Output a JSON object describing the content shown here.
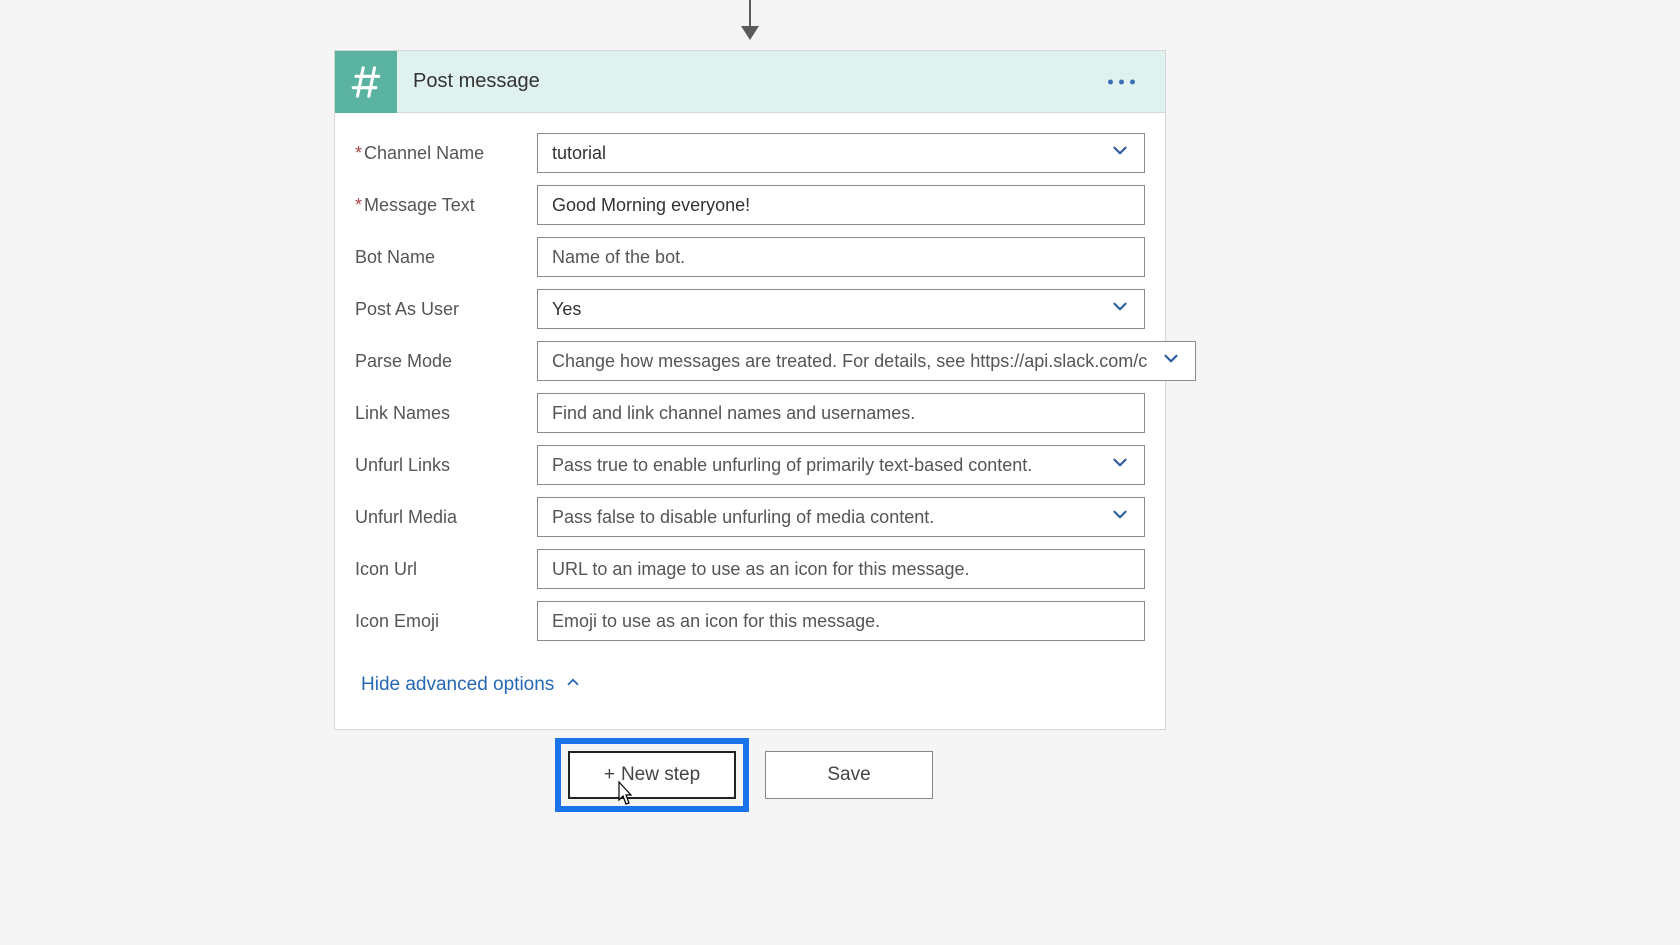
{
  "card": {
    "title": "Post message",
    "advanced_toggle_label": "Hide advanced options"
  },
  "fields": {
    "channel_name": {
      "label": "Channel Name",
      "value": "tutorial"
    },
    "message_text": {
      "label": "Message Text",
      "value": "Good Morning everyone!"
    },
    "bot_name": {
      "label": "Bot Name",
      "placeholder": "Name of the bot."
    },
    "post_as_user": {
      "label": "Post As User",
      "value": "Yes"
    },
    "parse_mode": {
      "label": "Parse Mode",
      "placeholder": "Change how messages are treated. For details, see https://api.slack.com/c"
    },
    "link_names": {
      "label": "Link Names",
      "placeholder": "Find and link channel names and usernames."
    },
    "unfurl_links": {
      "label": "Unfurl Links",
      "placeholder": "Pass true to enable unfurling of primarily text-based content."
    },
    "unfurl_media": {
      "label": "Unfurl Media",
      "placeholder": "Pass false to disable unfurling of media content."
    },
    "icon_url": {
      "label": "Icon Url",
      "placeholder": "URL to an image to use as an icon for this message."
    },
    "icon_emoji": {
      "label": "Icon Emoji",
      "placeholder": "Emoji to use as an icon for this message."
    }
  },
  "buttons": {
    "new_step_label": "New step",
    "save_label": "Save"
  }
}
